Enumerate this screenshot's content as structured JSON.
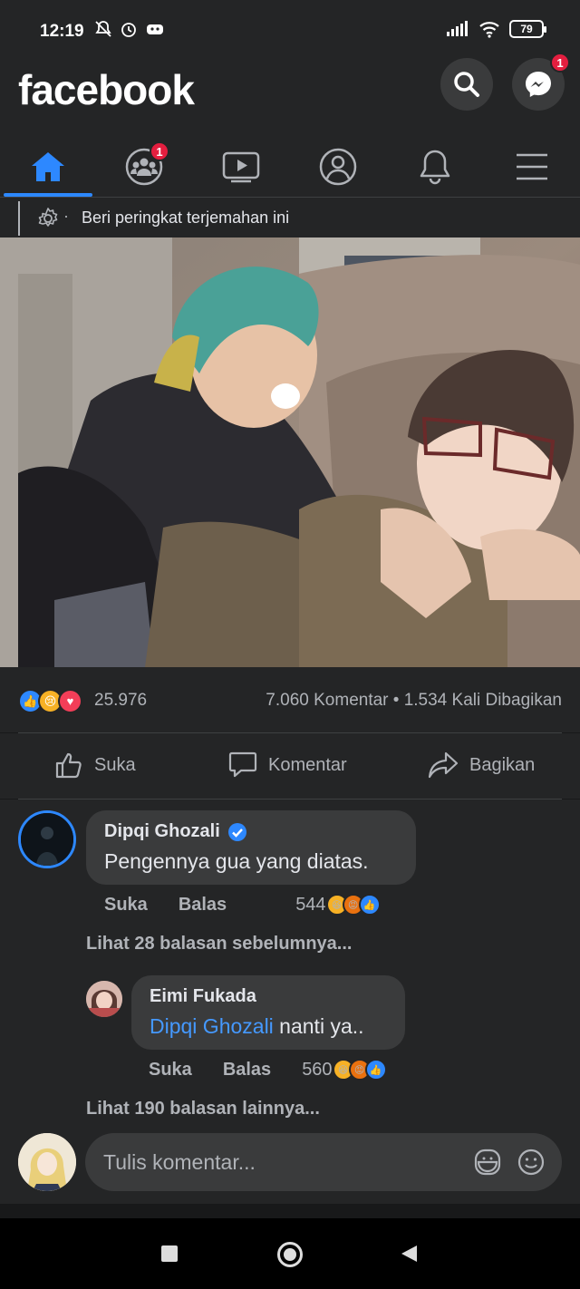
{
  "status": {
    "time": "12:19",
    "battery": "79"
  },
  "header": {
    "brand": "facebook",
    "messenger_badge": "1"
  },
  "nav": {
    "groups_badge": "1"
  },
  "translate": {
    "label": "Beri peringkat terjemahan ini"
  },
  "stats": {
    "reaction_count": "25.976",
    "comments_shares": "7.060 Komentar • 1.534 Kali Dibagikan"
  },
  "actions": {
    "like": "Suka",
    "comment": "Komentar",
    "share": "Bagikan"
  },
  "comments": [
    {
      "name": "Dipqi Ghozali",
      "text": "Pengennya gua yang diatas.",
      "like": "Suka",
      "reply": "Balas",
      "reaction_count": "544"
    }
  ],
  "more_replies_1": "Lihat 28 balasan sebelumnya...",
  "reply": {
    "name": "Eimi Fukada",
    "mention": "Dipqi Ghozali",
    "text": " nanti ya..",
    "like": "Suka",
    "reply": "Balas",
    "reaction_count": "560"
  },
  "more_replies_2": "Lihat 190 balasan lainnya...",
  "composer": {
    "placeholder": "Tulis komentar..."
  },
  "colors": {
    "accent": "#2d88ff",
    "badge": "#e41e3f",
    "background": "#242526",
    "bubble": "#3a3b3c"
  }
}
